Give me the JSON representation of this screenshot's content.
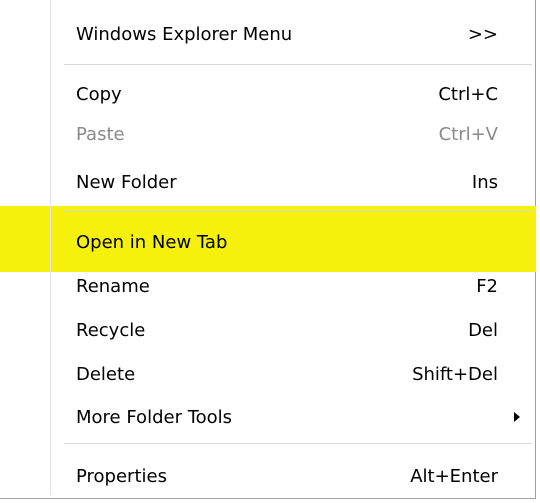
{
  "menu": {
    "header": {
      "label": "Windows Explorer Menu",
      "shortcut": ">>"
    },
    "items": [
      {
        "label": "Copy",
        "shortcut": "Ctrl+C",
        "enabled": true
      },
      {
        "label": "Paste",
        "shortcut": "Ctrl+V",
        "enabled": false
      },
      {
        "label": "New Folder",
        "shortcut": "Ins",
        "enabled": true
      },
      {
        "label": "Open in New Tab",
        "shortcut": "",
        "enabled": true,
        "highlighted": true
      },
      {
        "label": "Rename",
        "shortcut": "F2",
        "enabled": true
      },
      {
        "label": "Recycle",
        "shortcut": "Del",
        "enabled": true
      },
      {
        "label": "Delete",
        "shortcut": "Shift+Del",
        "enabled": true
      },
      {
        "label": "More Folder Tools",
        "shortcut": "",
        "enabled": true,
        "submenu_icon": "submenu-arrow-icon"
      },
      {
        "label": "Properties",
        "shortcut": "Alt+Enter",
        "enabled": true
      }
    ],
    "colors": {
      "highlight": "#f5f00c",
      "disabled_text": "#8a8a8a",
      "separator": "#d9d9d9"
    }
  }
}
